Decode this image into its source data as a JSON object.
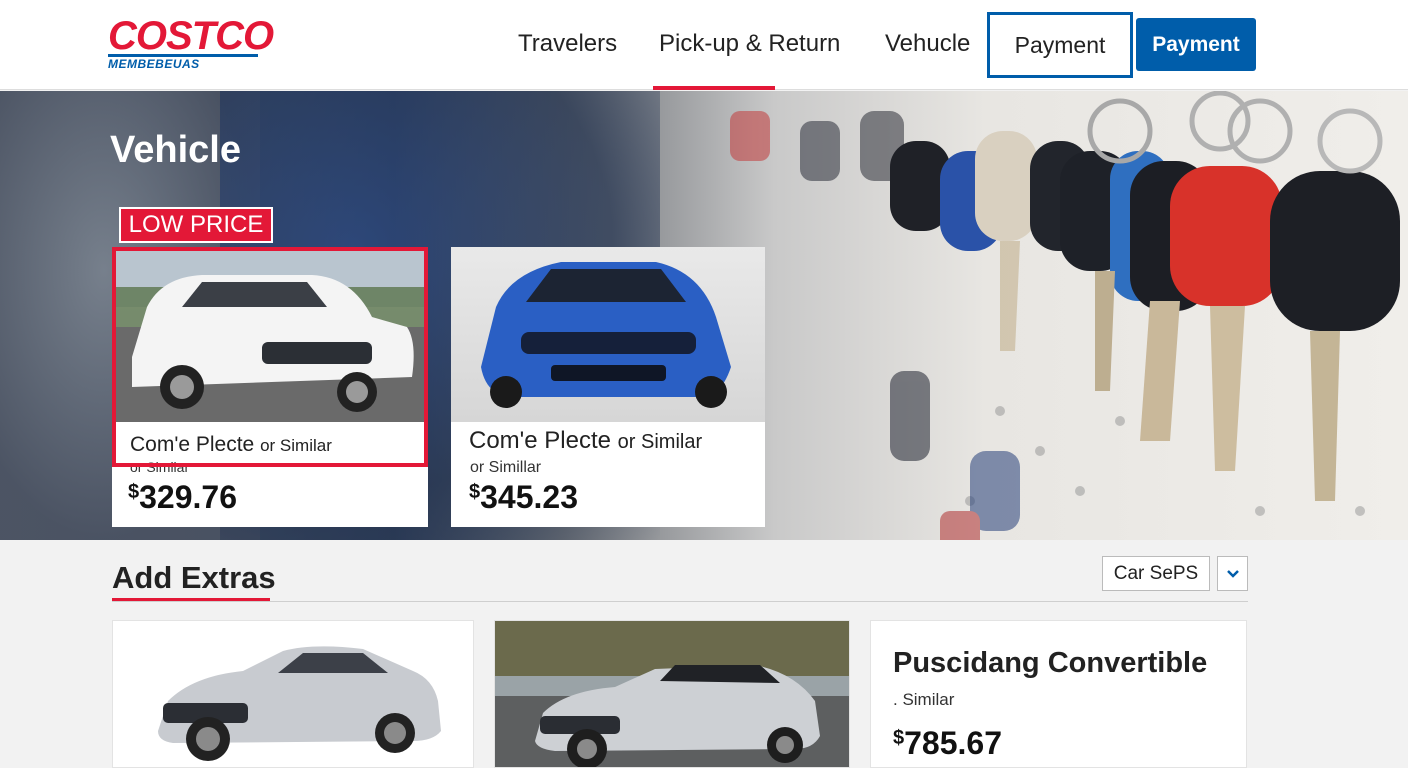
{
  "header": {
    "logo_main": "COSTCO",
    "logo_sub": "MEMBEBEUAS",
    "nav": [
      "Travelers",
      "Pick-up & Return",
      "Vehucle",
      "Payment"
    ],
    "payment_button": "Payment"
  },
  "hero": {
    "title": "Vehicle",
    "badge": "LOW PRICE",
    "cards": [
      {
        "name": "Com'e Plecte",
        "name_suffix": "or Similar",
        "sub": "or Similar",
        "currency": "$",
        "price": "329.76"
      },
      {
        "name": "Com'e Plecte",
        "name_suffix": "or Similar",
        "sub": "or Simillar",
        "currency": "$",
        "price": "345.23"
      }
    ]
  },
  "extras": {
    "title": "Add Extras",
    "select_value": "Car SePS",
    "cards": [
      {
        "title": "Puscidang Convertible",
        "sub": ". Similar",
        "currency": "$",
        "price": "785.67"
      }
    ]
  },
  "colors": {
    "brand_red": "#e31837",
    "brand_blue": "#005daa"
  },
  "icons": {
    "dropdown": "chevron-down-icon"
  }
}
